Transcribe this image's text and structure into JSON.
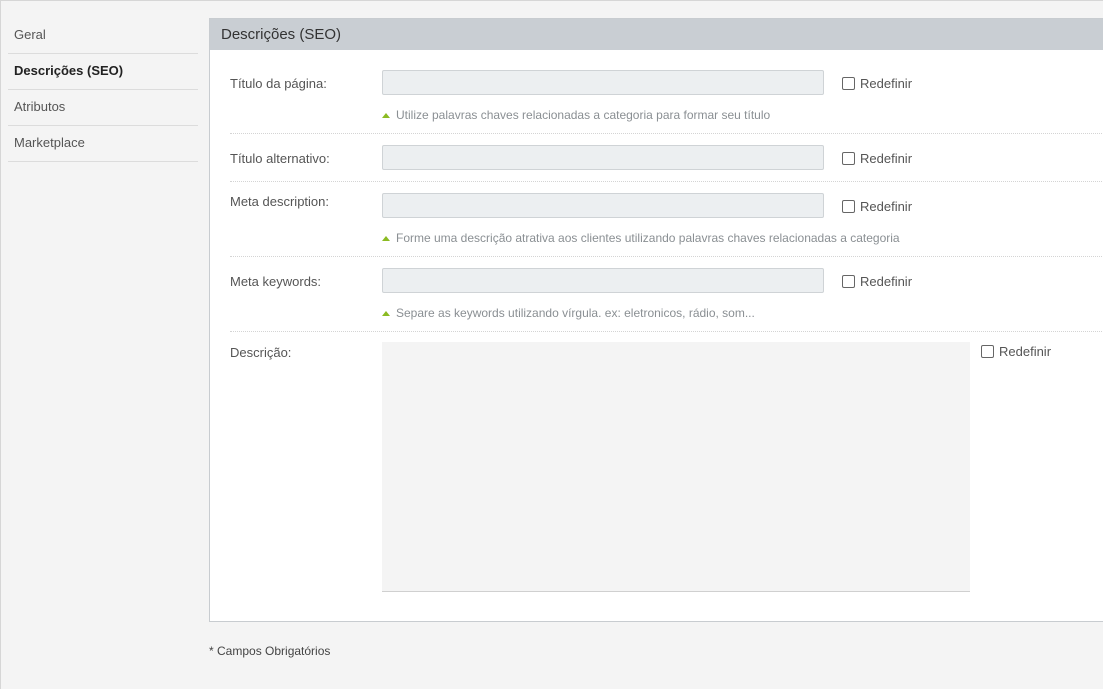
{
  "sidebar": {
    "items": [
      {
        "label": "Geral",
        "active": false
      },
      {
        "label": "Descrições (SEO)",
        "active": true
      },
      {
        "label": "Atributos",
        "active": false
      },
      {
        "label": "Marketplace",
        "active": false
      }
    ]
  },
  "panel": {
    "title": "Descrições (SEO)",
    "fields": {
      "page_title": {
        "label": "Título da página:",
        "value": "",
        "reset_label": "Redefinir",
        "hint": "Utilize palavras chaves relacionadas a categoria para formar seu título"
      },
      "alt_title": {
        "label": "Título alternativo:",
        "value": "",
        "reset_label": "Redefinir"
      },
      "meta_description": {
        "label": "Meta description:",
        "value": "",
        "reset_label": "Redefinir",
        "hint": "Forme uma descrição atrativa aos clientes utilizando palavras chaves relacionadas a categoria"
      },
      "meta_keywords": {
        "label": "Meta keywords:",
        "value": "",
        "reset_label": "Redefinir",
        "hint": "Separe as keywords utilizando vírgula. ex: eletronicos, rádio, som..."
      },
      "description": {
        "label": "Descrição:",
        "value": "",
        "reset_label": "Redefinir"
      }
    }
  },
  "footer": {
    "required_note": "* Campos Obrigatórios"
  },
  "colors": {
    "header_bg": "#c9ced3",
    "hint_arrow": "#8bbb22",
    "input_bg": "#eceff1"
  }
}
